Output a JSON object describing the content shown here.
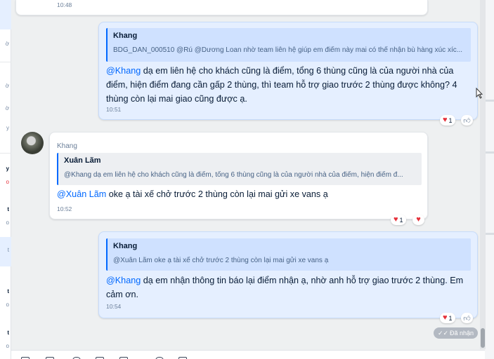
{
  "left_list": {
    "items": [
      {
        "text": "ờ",
        "style": "normal"
      },
      {
        "text": "ờ",
        "style": "normal"
      },
      {
        "text": "ờ",
        "style": "normal"
      },
      {
        "text": "y",
        "style": "normal"
      },
      {
        "text": "y",
        "style": "bold"
      },
      {
        "text": "o",
        "style": "red"
      },
      {
        "text": "t",
        "style": "bold"
      },
      {
        "text": "o",
        "style": "normal"
      },
      {
        "text": "t",
        "style": "normal"
      },
      {
        "text": "t",
        "style": "bold"
      },
      {
        "text": "o",
        "style": "normal"
      },
      {
        "text": "t",
        "style": "bold"
      },
      {
        "text": "o",
        "style": "normal"
      }
    ]
  },
  "messages": [
    {
      "id": "prev",
      "time": "10:48"
    },
    {
      "id": "m1",
      "direction": "outgoing",
      "quote": {
        "name": "Khang",
        "text": "BDG_DAN_000510 @Rú @Dương Loan nhờ team liên hệ giúp em điểm này mai có thể nhận bù hàng xúc xíc..."
      },
      "mention": "@Khang",
      "body": " dạ em liên hệ cho khách cũng là điểm, tổng 6 thùng cũng là của người nhà của điểm, hiện điểm đang cần gấp 2 thùng, thì team hỗ trợ giao trước 2 thùng được không? 4 thùng còn lại mai giao cũng được ạ.",
      "time": "10:51",
      "reaction": {
        "icon": "heart",
        "count": "1"
      }
    },
    {
      "id": "m2",
      "direction": "incoming",
      "sender": "Khang",
      "quote": {
        "name": "Xuân Lãm",
        "text": "@Khang dạ em liên hệ cho khách cũng là điểm, tổng 6 thùng cũng là của người nhà của điểm, hiện điểm đ..."
      },
      "mention": "@Xuân Lãm",
      "body": " oke ạ tài xế chở trước 2 thùng còn lại mai gửi xe vans ạ",
      "time": "10:52",
      "reaction": {
        "icon": "heart",
        "count": "1"
      }
    },
    {
      "id": "m3",
      "direction": "outgoing",
      "quote": {
        "name": "Khang",
        "text": "@Xuân Lãm oke ạ tài xế chở trước 2 thùng còn lại mai gửi xe vans ạ"
      },
      "mention": "@Khang",
      "body": " dạ em nhận thông tin báo lại điểm nhận ạ, nhờ anh hỗ trợ giao trước 2 thùng. Em cảm ơn.",
      "time": "10:54",
      "reaction": {
        "icon": "heart",
        "count": "1"
      }
    }
  ],
  "status": {
    "received_label": "Đã nhận",
    "received_icon": "double-check-icon"
  },
  "colors": {
    "accent": "#0068ff",
    "bubble_mine": "#e5efff",
    "heart": "#e5303a"
  }
}
